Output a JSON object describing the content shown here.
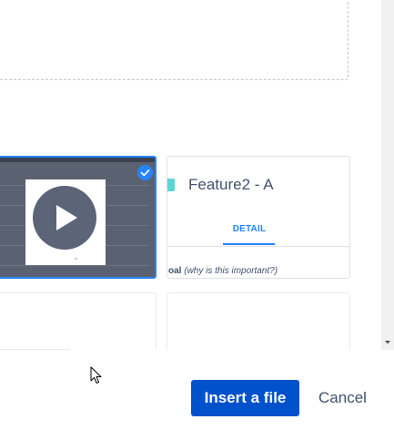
{
  "gallery": {
    "items": [
      {
        "kind": "video",
        "selected": true,
        "icons": [
          "play-icon",
          "checkmark-icon"
        ],
        "badge_color": "#2684ff"
      },
      {
        "kind": "document",
        "title": "Feature2 - A",
        "tab_label": "DETAIL",
        "goal_bold": "oal",
        "goal_italic": "(why is this important?)",
        "swatch_color": "#5ad6d0"
      },
      {
        "kind": "blank"
      },
      {
        "kind": "blank"
      }
    ]
  },
  "scrollbar": {
    "down_arrow_icon": "triangle-down-icon"
  },
  "footer": {
    "insert_label": "Insert a file",
    "cancel_label": "Cancel",
    "primary_color": "#0052cc"
  }
}
